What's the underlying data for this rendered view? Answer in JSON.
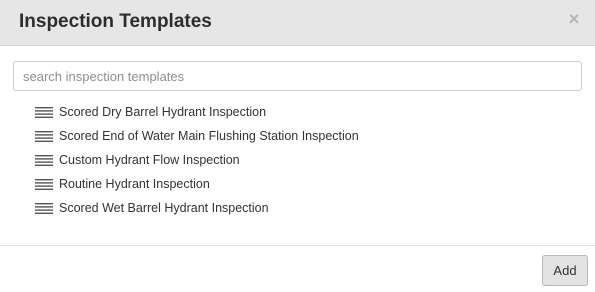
{
  "modal": {
    "title": "Inspection Templates",
    "close_label": "×"
  },
  "search": {
    "placeholder": "search inspection templates",
    "value": ""
  },
  "templates": [
    {
      "label": "Scored Dry Barrel Hydrant Inspection",
      "icon": "drag-handle-icon"
    },
    {
      "label": "Scored End of Water Main Flushing Station Inspection",
      "icon": "drag-handle-icon"
    },
    {
      "label": "Custom Hydrant Flow Inspection",
      "icon": "drag-handle-icon"
    },
    {
      "label": "Routine Hydrant Inspection",
      "icon": "drag-handle-icon"
    },
    {
      "label": "Scored Wet Barrel Hydrant Inspection",
      "icon": "drag-handle-icon"
    }
  ],
  "footer": {
    "add_label": "Add"
  },
  "colors": {
    "header_bg": "#e6e6e6",
    "button_bg": "#e3e3e3",
    "text": "#333333"
  }
}
